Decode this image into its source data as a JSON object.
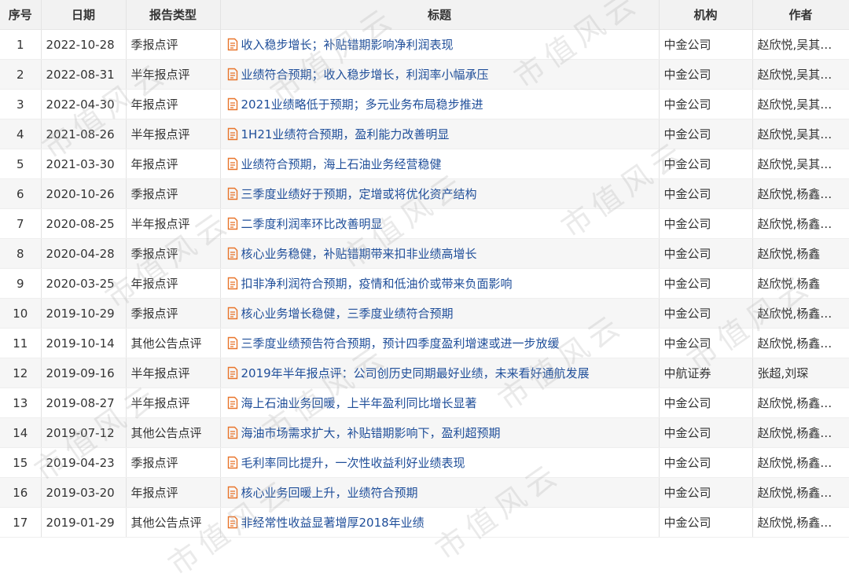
{
  "table": {
    "headers": {
      "no": "序号",
      "date": "日期",
      "type": "报告类型",
      "title": "标题",
      "org": "机构",
      "author": "作者"
    },
    "rows": [
      {
        "no": "1",
        "date": "2022-10-28",
        "type": "季报点评",
        "title": "收入稳步增长；补贴错期影响净利润表现",
        "org": "中金公司",
        "author": "赵欣悦,吴其…"
      },
      {
        "no": "2",
        "date": "2022-08-31",
        "type": "半年报点评",
        "title": "业绩符合预期；收入稳步增长，利润率小幅承压",
        "org": "中金公司",
        "author": "赵欣悦,吴其…"
      },
      {
        "no": "3",
        "date": "2022-04-30",
        "type": "年报点评",
        "title": "2021业绩略低于预期；多元业务布局稳步推进",
        "org": "中金公司",
        "author": "赵欣悦,吴其…"
      },
      {
        "no": "4",
        "date": "2021-08-26",
        "type": "半年报点评",
        "title": "1H21业绩符合预期，盈利能力改善明显",
        "org": "中金公司",
        "author": "赵欣悦,吴其…"
      },
      {
        "no": "5",
        "date": "2021-03-30",
        "type": "年报点评",
        "title": "业绩符合预期，海上石油业务经营稳健",
        "org": "中金公司",
        "author": "赵欣悦,吴其…"
      },
      {
        "no": "6",
        "date": "2020-10-26",
        "type": "季报点评",
        "title": "三季度业绩好于预期，定增或将优化资产结构",
        "org": "中金公司",
        "author": "赵欣悦,杨鑫…"
      },
      {
        "no": "7",
        "date": "2020-08-25",
        "type": "半年报点评",
        "title": "二季度利润率环比改善明显",
        "org": "中金公司",
        "author": "赵欣悦,杨鑫…"
      },
      {
        "no": "8",
        "date": "2020-04-28",
        "type": "季报点评",
        "title": "核心业务稳健，补贴错期带来扣非业绩高增长",
        "org": "中金公司",
        "author": "赵欣悦,杨鑫"
      },
      {
        "no": "9",
        "date": "2020-03-25",
        "type": "年报点评",
        "title": "扣非净利润符合预期，疫情和低油价或带来负面影响",
        "org": "中金公司",
        "author": "赵欣悦,杨鑫"
      },
      {
        "no": "10",
        "date": "2019-10-29",
        "type": "季报点评",
        "title": "核心业务增长稳健，三季度业绩符合预期",
        "org": "中金公司",
        "author": "赵欣悦,杨鑫…"
      },
      {
        "no": "11",
        "date": "2019-10-14",
        "type": "其他公告点评",
        "title": "三季度业绩预告符合预期，预计四季度盈利增速或进一步放缓",
        "org": "中金公司",
        "author": "赵欣悦,杨鑫…"
      },
      {
        "no": "12",
        "date": "2019-09-16",
        "type": "半年报点评",
        "title": "2019年半年报点评：公司创历史同期最好业绩，未来看好通航发展",
        "org": "中航证券",
        "author": "张超,刘琛"
      },
      {
        "no": "13",
        "date": "2019-08-27",
        "type": "半年报点评",
        "title": "海上石油业务回暖，上半年盈利同比增长显著",
        "org": "中金公司",
        "author": "赵欣悦,杨鑫…"
      },
      {
        "no": "14",
        "date": "2019-07-12",
        "type": "其他公告点评",
        "title": "海油市场需求扩大，补贴错期影响下，盈利超预期",
        "org": "中金公司",
        "author": "赵欣悦,杨鑫…"
      },
      {
        "no": "15",
        "date": "2019-04-23",
        "type": "季报点评",
        "title": "毛利率同比提升，一次性收益利好业绩表现",
        "org": "中金公司",
        "author": "赵欣悦,杨鑫…"
      },
      {
        "no": "16",
        "date": "2019-03-20",
        "type": "年报点评",
        "title": "核心业务回暖上升，业绩符合预期",
        "org": "中金公司",
        "author": "赵欣悦,杨鑫…"
      },
      {
        "no": "17",
        "date": "2019-01-29",
        "type": "其他公告点评",
        "title": "非经常性收益显著增厚2018年业绩",
        "org": "中金公司",
        "author": "赵欣悦,杨鑫…"
      }
    ]
  },
  "watermark": "市值风云",
  "icon": "document-icon",
  "colors": {
    "link": "#1f4e99",
    "icon": "#e8742a",
    "header_bg": "#f2f2f2",
    "stripe_bg": "#f6f6f6"
  }
}
